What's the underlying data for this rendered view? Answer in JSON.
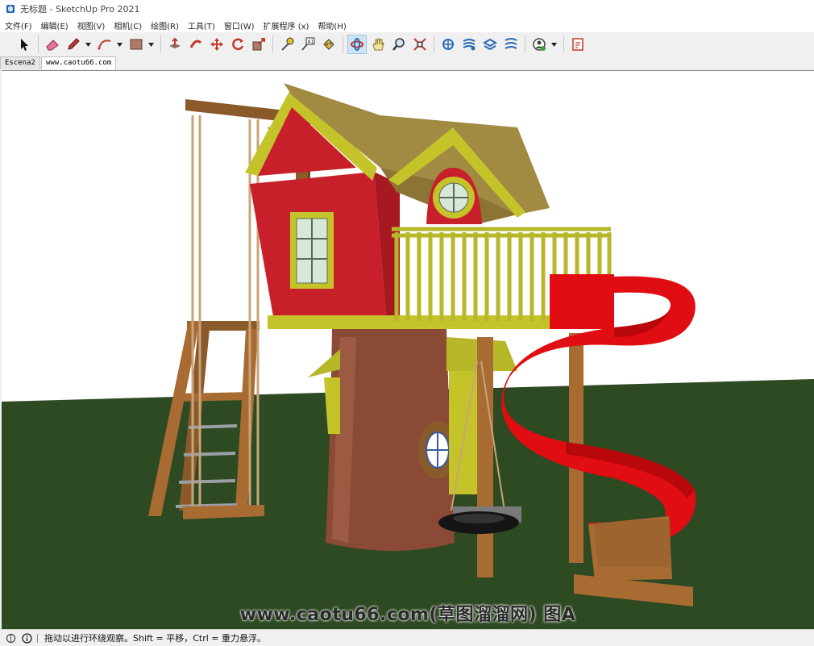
{
  "window": {
    "title": "无标题 - SketchUp Pro 2021"
  },
  "menu": [
    "文件(F)",
    "编辑(E)",
    "视图(V)",
    "相机(C)",
    "绘图(R)",
    "工具(T)",
    "窗口(W)",
    "扩展程序 (x)",
    "帮助(H)"
  ],
  "toolbar": {
    "tools": [
      "select-icon",
      "eraser-icon",
      "pencil-icon",
      "arc-icon",
      "rectangle-icon",
      "push-pull-icon",
      "follow-me-icon",
      "move-icon",
      "rotate-icon",
      "scale-icon",
      "tape-measure-icon",
      "text-icon",
      "paint-bucket-icon",
      "orbit-icon",
      "pan-icon",
      "zoom-icon",
      "zoom-extents-icon",
      "warehouse-icon",
      "extension-warehouse-icon",
      "layout-icon",
      "components-icon",
      "account-icon",
      "profile-icon"
    ],
    "active_tool": "orbit-icon"
  },
  "scene_tabs": [
    "Escena2",
    "www.caotu66.com"
  ],
  "active_tab": "www.caotu66.com",
  "model": {
    "sky_color": "#ffffff",
    "ground_color": "#2e4a22"
  },
  "watermark": "www.caotu66.com(草图溜溜网) 图A",
  "status": {
    "text": "拖动以进行环绕观察。Shift = 平移，Ctrl = 重力悬浮。"
  }
}
